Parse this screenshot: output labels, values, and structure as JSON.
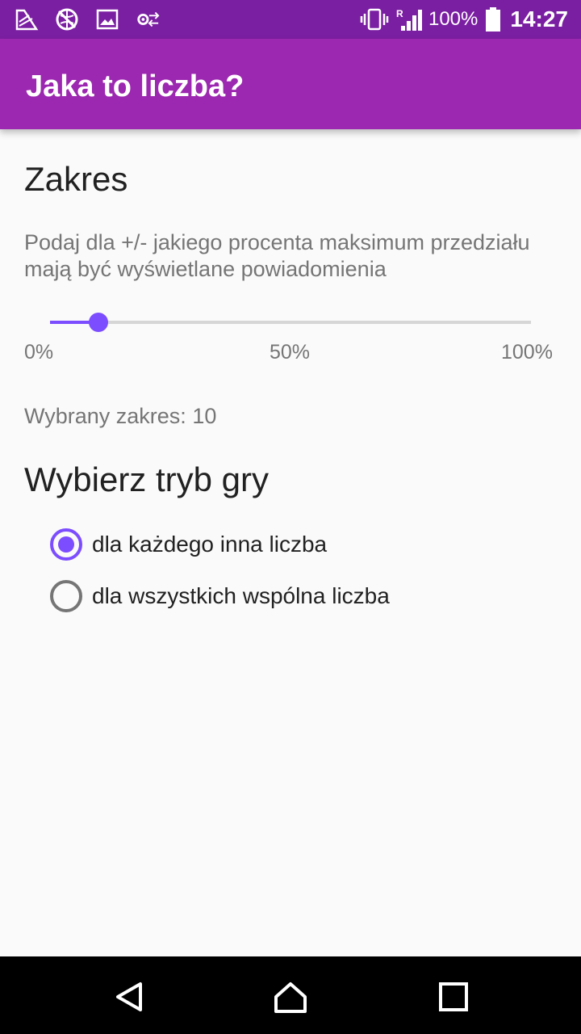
{
  "status_bar": {
    "icons_left": [
      "notification-app-icon",
      "no-sync-icon",
      "image-icon",
      "settings-sync-icon"
    ],
    "network_badge": "R",
    "battery_pct": "100%",
    "time": "14:27"
  },
  "app_bar": {
    "title": "Jaka to liczba?"
  },
  "range_section": {
    "title": "Zakres",
    "description": "Podaj dla +/- jakiego procenta maksimum przedziału mają być wyświetlane powiadomienia",
    "slider": {
      "value": 10,
      "min": 0,
      "max": 100
    },
    "ticks": [
      "0%",
      "50%",
      "100%"
    ],
    "selected_text": "Wybrany zakres: 10"
  },
  "mode_section": {
    "title": "Wybierz tryb gry",
    "options": [
      {
        "label": "dla każdego inna liczba",
        "checked": true
      },
      {
        "label": "dla wszystkich wspólna liczba",
        "checked": false
      }
    ]
  },
  "colors": {
    "status_bar": "#7b1fa2",
    "app_bar": "#9c27b0",
    "accent": "#7c4dff"
  },
  "nav_bar": {
    "buttons": [
      "back-icon",
      "home-icon",
      "recents-icon"
    ]
  }
}
